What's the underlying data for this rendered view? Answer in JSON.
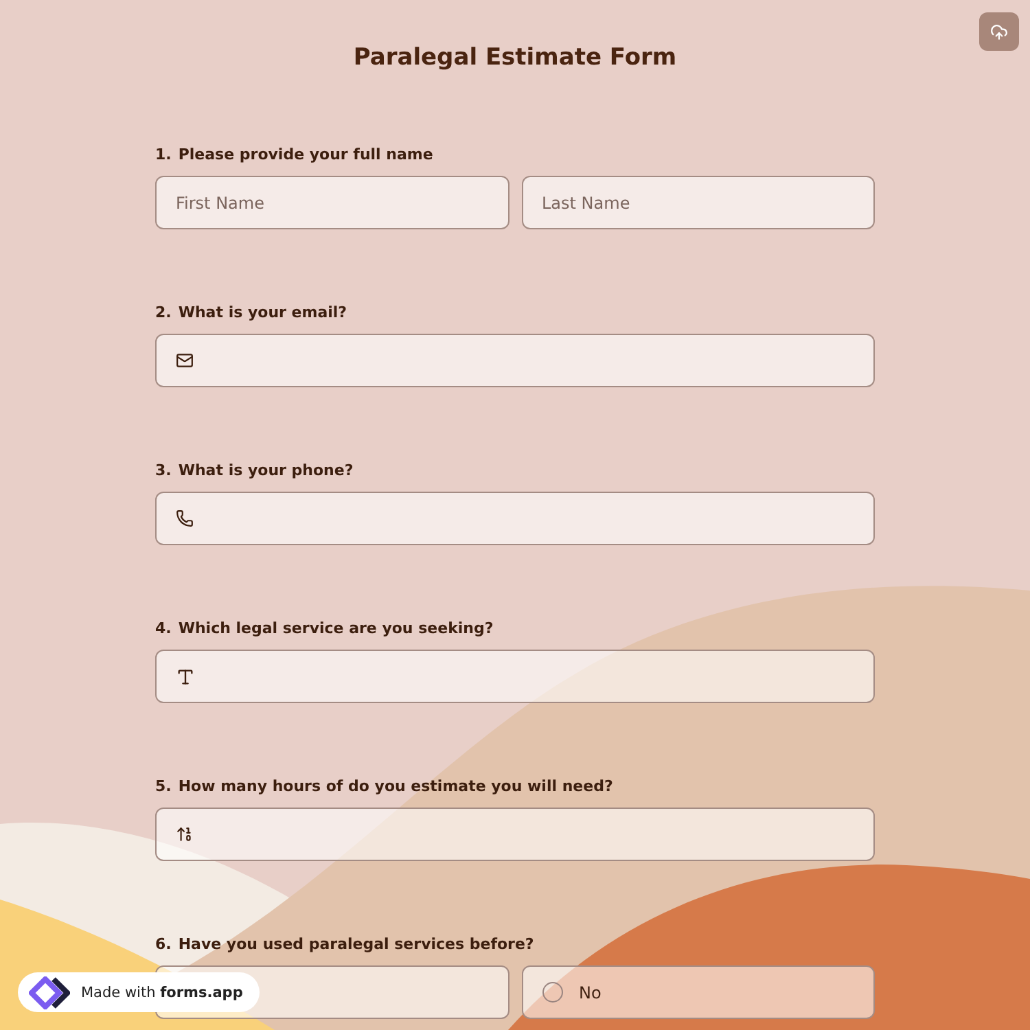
{
  "title": "Paralegal Estimate Form",
  "questions": [
    {
      "number": "1.",
      "label": "Please provide your full name",
      "kind": "name",
      "fields": [
        {
          "placeholder": "First Name"
        },
        {
          "placeholder": "Last Name"
        }
      ]
    },
    {
      "number": "2.",
      "label": "What is your email?",
      "kind": "email"
    },
    {
      "number": "3.",
      "label": "What is your phone?",
      "kind": "phone"
    },
    {
      "number": "4.",
      "label": "Which legal service are you seeking?",
      "kind": "text"
    },
    {
      "number": "5.",
      "label": "How many hours of do you estimate you will need?",
      "kind": "number"
    },
    {
      "number": "6.",
      "label": "Have you used paralegal services before?",
      "kind": "choice",
      "options": [
        {
          "kind": "covered"
        },
        {
          "kind": "radio",
          "label": "No",
          "selected": false
        }
      ]
    }
  ],
  "badge": {
    "text": "Made with **forms.app**"
  }
}
